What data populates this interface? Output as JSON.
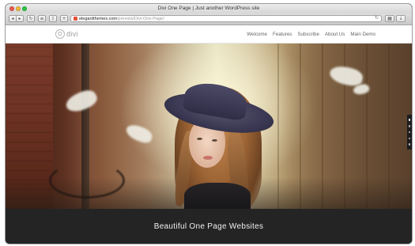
{
  "window": {
    "title": "Divi One Page | Just another WordPress site"
  },
  "toolbar": {
    "back_icon": "back-arrow-icon",
    "forward_icon": "forward-arrow-icon",
    "url_domain": "elegantthemes.com",
    "url_path": "/preview/Divi-One-Page/"
  },
  "site": {
    "logo_mark": "D",
    "logo_text": "divi",
    "nav": {
      "items": [
        "Welcome",
        "Features",
        "Subscribe",
        "About Us",
        "Main Demo"
      ]
    }
  },
  "hero": {
    "caption": "Beautiful One Page Websites",
    "slider_dots": 5,
    "active_dot": 1
  },
  "colors": {
    "caption_band": "#242424",
    "logo_gray": "#9a9a9a",
    "nav_text": "#666666"
  }
}
